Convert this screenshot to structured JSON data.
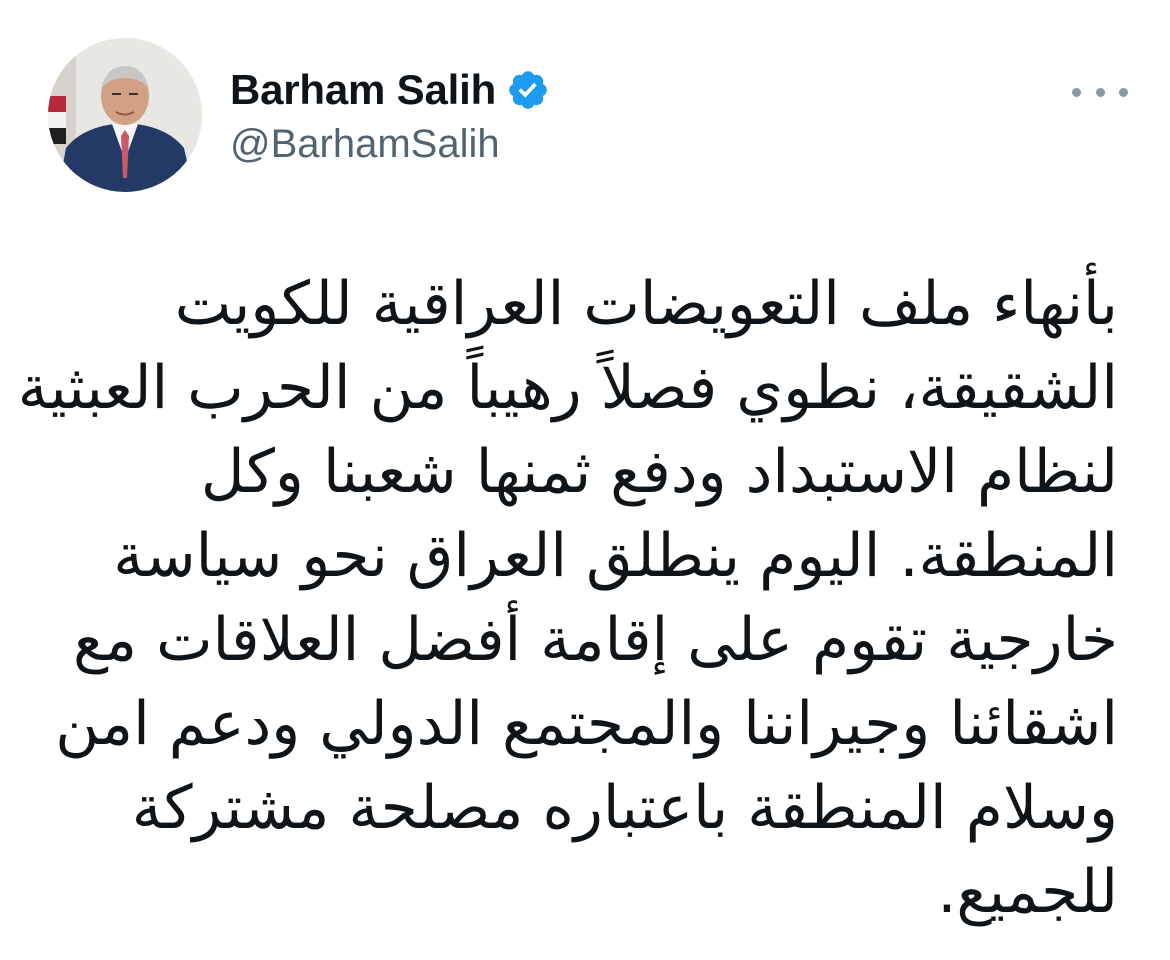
{
  "user": {
    "display_name": "Barham Salih",
    "handle": "@BarhamSalih",
    "verified": true
  },
  "tweet": {
    "lines": [
      "بأنهاء ملف التعويضات العراقية للكويت",
      "الشقيقة، نطوي فصلاً رهيباً من الحرب العبثية",
      "لنظام الاستبداد ودفع ثمنها شعبنا وكل",
      "المنطقة. اليوم ينطلق العراق نحو سياسة",
      "خارجية تقوم على إقامة أفضل العلاقات مع",
      "اشقائنا وجيراننا والمجتمع الدولي ودعم امن",
      "وسلام المنطقة باعتباره مصلحة مشتركة",
      "للجميع."
    ]
  },
  "icons": {
    "verified": "verified-badge-icon",
    "more": "more-options-icon"
  },
  "colors": {
    "text": "#0f1419",
    "secondary": "#536471",
    "verified": "#1d9bf0",
    "more": "#8899a6"
  }
}
